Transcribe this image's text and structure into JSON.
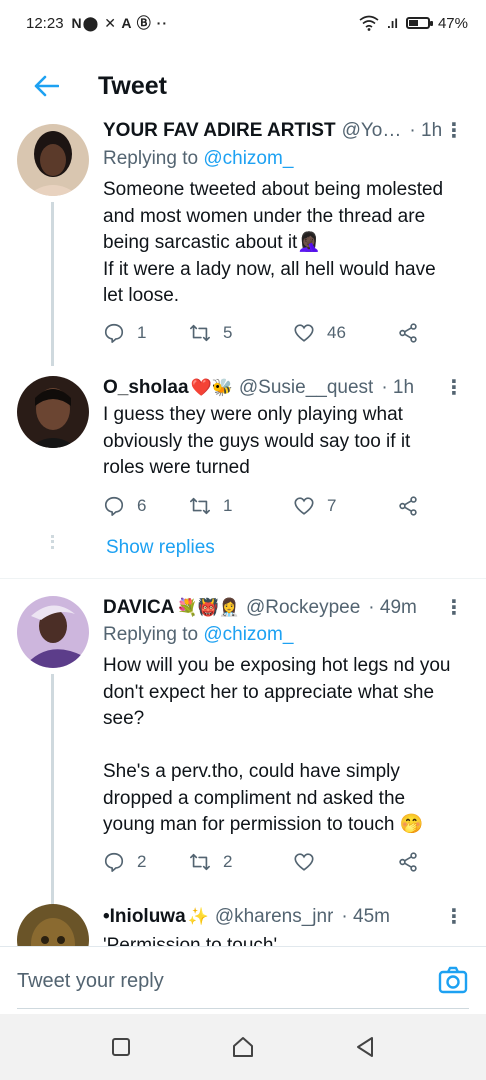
{
  "status_bar": {
    "time": "12:23",
    "icons": "N⬤ ✕ A Ⓑ ··",
    "signal": ".ıl",
    "battery_percent": "47%",
    "battery_level": 0.47
  },
  "header": {
    "title": "Tweet"
  },
  "tweets": [
    {
      "name": "YOUR FAV ADIRE ARTIST",
      "emojis": "",
      "handle": "@Yo…",
      "time": "· 1h",
      "replying_label": "Replying to ",
      "replying_to": "@chizom_",
      "text": "Someone tweeted about being molested and most women under the thread are being sarcastic about it🤦🏿‍♀️\nIf it were a lady now, all hell would have let loose.",
      "replies": "1",
      "retweets": "5",
      "likes": "46"
    },
    {
      "name": "O_sholaa",
      "emojis": "❤️🐝",
      "handle": "@Susie__quest",
      "time": "· 1h",
      "text": "I guess they were only playing what obviously the guys would say too if it roles were turned",
      "replies": "6",
      "retweets": "1",
      "likes": "7",
      "show_replies": "Show replies"
    },
    {
      "name": "DAVICA",
      "emojis": "💐👹👩‍⚕️",
      "handle": "@Rockeypee",
      "time": "· 49m",
      "replying_label": "Replying to ",
      "replying_to": "@chizom_",
      "text": "How will you be exposing hot legs nd you don't expect her to appreciate what she see?\n\nShe's a perv.tho,  could have simply dropped a compliment nd asked the young man for permission to touch 🤭",
      "replies": "2",
      "retweets": "2",
      "likes": ""
    },
    {
      "name": "•Inioluwa",
      "emojis": "✨",
      "handle": "@kharens_jnr",
      "time": "· 45m",
      "text": "'Permission to touch'"
    }
  ],
  "compose": {
    "placeholder": "Tweet your reply"
  },
  "colors": {
    "accent": "#1da1f2",
    "secondary_text": "#536471",
    "thread_line": "#cfd9de"
  },
  "icons": [
    "back-arrow-icon",
    "more-icon",
    "reply-icon",
    "retweet-icon",
    "like-icon",
    "share-icon",
    "camera-icon",
    "recents-icon",
    "home-icon",
    "back-triangle-icon"
  ]
}
